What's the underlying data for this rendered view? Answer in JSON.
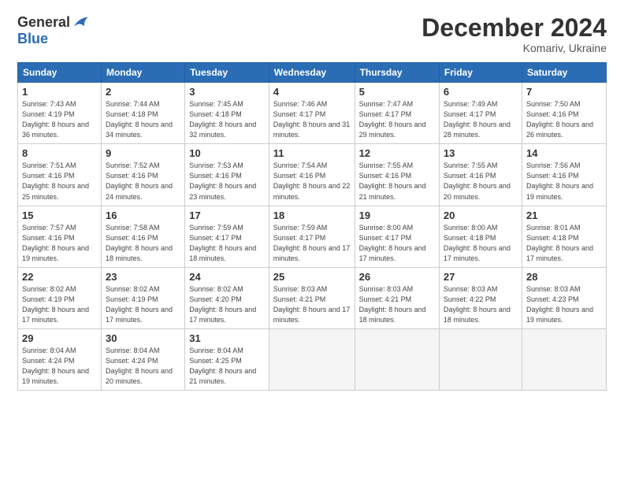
{
  "header": {
    "logo_general": "General",
    "logo_blue": "Blue",
    "month_title": "December 2024",
    "subtitle": "Komariv, Ukraine"
  },
  "weekdays": [
    "Sunday",
    "Monday",
    "Tuesday",
    "Wednesday",
    "Thursday",
    "Friday",
    "Saturday"
  ],
  "weeks": [
    [
      {
        "day": "1",
        "sunrise": "Sunrise: 7:43 AM",
        "sunset": "Sunset: 4:19 PM",
        "daylight": "Daylight: 8 hours and 36 minutes."
      },
      {
        "day": "2",
        "sunrise": "Sunrise: 7:44 AM",
        "sunset": "Sunset: 4:18 PM",
        "daylight": "Daylight: 8 hours and 34 minutes."
      },
      {
        "day": "3",
        "sunrise": "Sunrise: 7:45 AM",
        "sunset": "Sunset: 4:18 PM",
        "daylight": "Daylight: 8 hours and 32 minutes."
      },
      {
        "day": "4",
        "sunrise": "Sunrise: 7:46 AM",
        "sunset": "Sunset: 4:17 PM",
        "daylight": "Daylight: 8 hours and 31 minutes."
      },
      {
        "day": "5",
        "sunrise": "Sunrise: 7:47 AM",
        "sunset": "Sunset: 4:17 PM",
        "daylight": "Daylight: 8 hours and 29 minutes."
      },
      {
        "day": "6",
        "sunrise": "Sunrise: 7:49 AM",
        "sunset": "Sunset: 4:17 PM",
        "daylight": "Daylight: 8 hours and 28 minutes."
      },
      {
        "day": "7",
        "sunrise": "Sunrise: 7:50 AM",
        "sunset": "Sunset: 4:16 PM",
        "daylight": "Daylight: 8 hours and 26 minutes."
      }
    ],
    [
      {
        "day": "8",
        "sunrise": "Sunrise: 7:51 AM",
        "sunset": "Sunset: 4:16 PM",
        "daylight": "Daylight: 8 hours and 25 minutes."
      },
      {
        "day": "9",
        "sunrise": "Sunrise: 7:52 AM",
        "sunset": "Sunset: 4:16 PM",
        "daylight": "Daylight: 8 hours and 24 minutes."
      },
      {
        "day": "10",
        "sunrise": "Sunrise: 7:53 AM",
        "sunset": "Sunset: 4:16 PM",
        "daylight": "Daylight: 8 hours and 23 minutes."
      },
      {
        "day": "11",
        "sunrise": "Sunrise: 7:54 AM",
        "sunset": "Sunset: 4:16 PM",
        "daylight": "Daylight: 8 hours and 22 minutes."
      },
      {
        "day": "12",
        "sunrise": "Sunrise: 7:55 AM",
        "sunset": "Sunset: 4:16 PM",
        "daylight": "Daylight: 8 hours and 21 minutes."
      },
      {
        "day": "13",
        "sunrise": "Sunrise: 7:55 AM",
        "sunset": "Sunset: 4:16 PM",
        "daylight": "Daylight: 8 hours and 20 minutes."
      },
      {
        "day": "14",
        "sunrise": "Sunrise: 7:56 AM",
        "sunset": "Sunset: 4:16 PM",
        "daylight": "Daylight: 8 hours and 19 minutes."
      }
    ],
    [
      {
        "day": "15",
        "sunrise": "Sunrise: 7:57 AM",
        "sunset": "Sunset: 4:16 PM",
        "daylight": "Daylight: 8 hours and 19 minutes."
      },
      {
        "day": "16",
        "sunrise": "Sunrise: 7:58 AM",
        "sunset": "Sunset: 4:16 PM",
        "daylight": "Daylight: 8 hours and 18 minutes."
      },
      {
        "day": "17",
        "sunrise": "Sunrise: 7:59 AM",
        "sunset": "Sunset: 4:17 PM",
        "daylight": "Daylight: 8 hours and 18 minutes."
      },
      {
        "day": "18",
        "sunrise": "Sunrise: 7:59 AM",
        "sunset": "Sunset: 4:17 PM",
        "daylight": "Daylight: 8 hours and 17 minutes."
      },
      {
        "day": "19",
        "sunrise": "Sunrise: 8:00 AM",
        "sunset": "Sunset: 4:17 PM",
        "daylight": "Daylight: 8 hours and 17 minutes."
      },
      {
        "day": "20",
        "sunrise": "Sunrise: 8:00 AM",
        "sunset": "Sunset: 4:18 PM",
        "daylight": "Daylight: 8 hours and 17 minutes."
      },
      {
        "day": "21",
        "sunrise": "Sunrise: 8:01 AM",
        "sunset": "Sunset: 4:18 PM",
        "daylight": "Daylight: 8 hours and 17 minutes."
      }
    ],
    [
      {
        "day": "22",
        "sunrise": "Sunrise: 8:02 AM",
        "sunset": "Sunset: 4:19 PM",
        "daylight": "Daylight: 8 hours and 17 minutes."
      },
      {
        "day": "23",
        "sunrise": "Sunrise: 8:02 AM",
        "sunset": "Sunset: 4:19 PM",
        "daylight": "Daylight: 8 hours and 17 minutes."
      },
      {
        "day": "24",
        "sunrise": "Sunrise: 8:02 AM",
        "sunset": "Sunset: 4:20 PM",
        "daylight": "Daylight: 8 hours and 17 minutes."
      },
      {
        "day": "25",
        "sunrise": "Sunrise: 8:03 AM",
        "sunset": "Sunset: 4:21 PM",
        "daylight": "Daylight: 8 hours and 17 minutes."
      },
      {
        "day": "26",
        "sunrise": "Sunrise: 8:03 AM",
        "sunset": "Sunset: 4:21 PM",
        "daylight": "Daylight: 8 hours and 18 minutes."
      },
      {
        "day": "27",
        "sunrise": "Sunrise: 8:03 AM",
        "sunset": "Sunset: 4:22 PM",
        "daylight": "Daylight: 8 hours and 18 minutes."
      },
      {
        "day": "28",
        "sunrise": "Sunrise: 8:03 AM",
        "sunset": "Sunset: 4:23 PM",
        "daylight": "Daylight: 8 hours and 19 minutes."
      }
    ],
    [
      {
        "day": "29",
        "sunrise": "Sunrise: 8:04 AM",
        "sunset": "Sunset: 4:24 PM",
        "daylight": "Daylight: 8 hours and 19 minutes."
      },
      {
        "day": "30",
        "sunrise": "Sunrise: 8:04 AM",
        "sunset": "Sunset: 4:24 PM",
        "daylight": "Daylight: 8 hours and 20 minutes."
      },
      {
        "day": "31",
        "sunrise": "Sunrise: 8:04 AM",
        "sunset": "Sunset: 4:25 PM",
        "daylight": "Daylight: 8 hours and 21 minutes."
      },
      null,
      null,
      null,
      null
    ]
  ]
}
